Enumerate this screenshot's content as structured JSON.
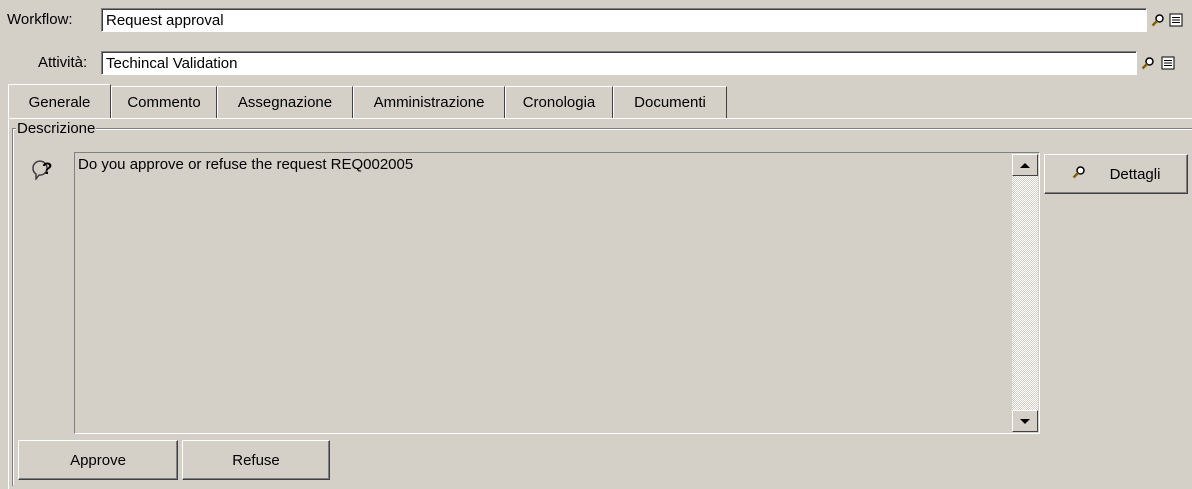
{
  "workflow": {
    "label": "Workflow:",
    "value": "Request approval"
  },
  "activity": {
    "label": "Attività:",
    "value": "Techincal Validation"
  },
  "tabs": [
    {
      "label": "Generale",
      "active": true
    },
    {
      "label": "Commento"
    },
    {
      "label": "Assegnazione"
    },
    {
      "label": "Amministrazione"
    },
    {
      "label": "Cronologia"
    },
    {
      "label": "Documenti"
    }
  ],
  "description": {
    "legend": "Descrizione",
    "icon": "question-bubble-icon",
    "text": "Do you approve or refuse the request REQ002005"
  },
  "details_button": {
    "label": "Dettagli",
    "icon": "magnifier-icon"
  },
  "actions": {
    "approve": "Approve",
    "refuse": "Refuse"
  }
}
